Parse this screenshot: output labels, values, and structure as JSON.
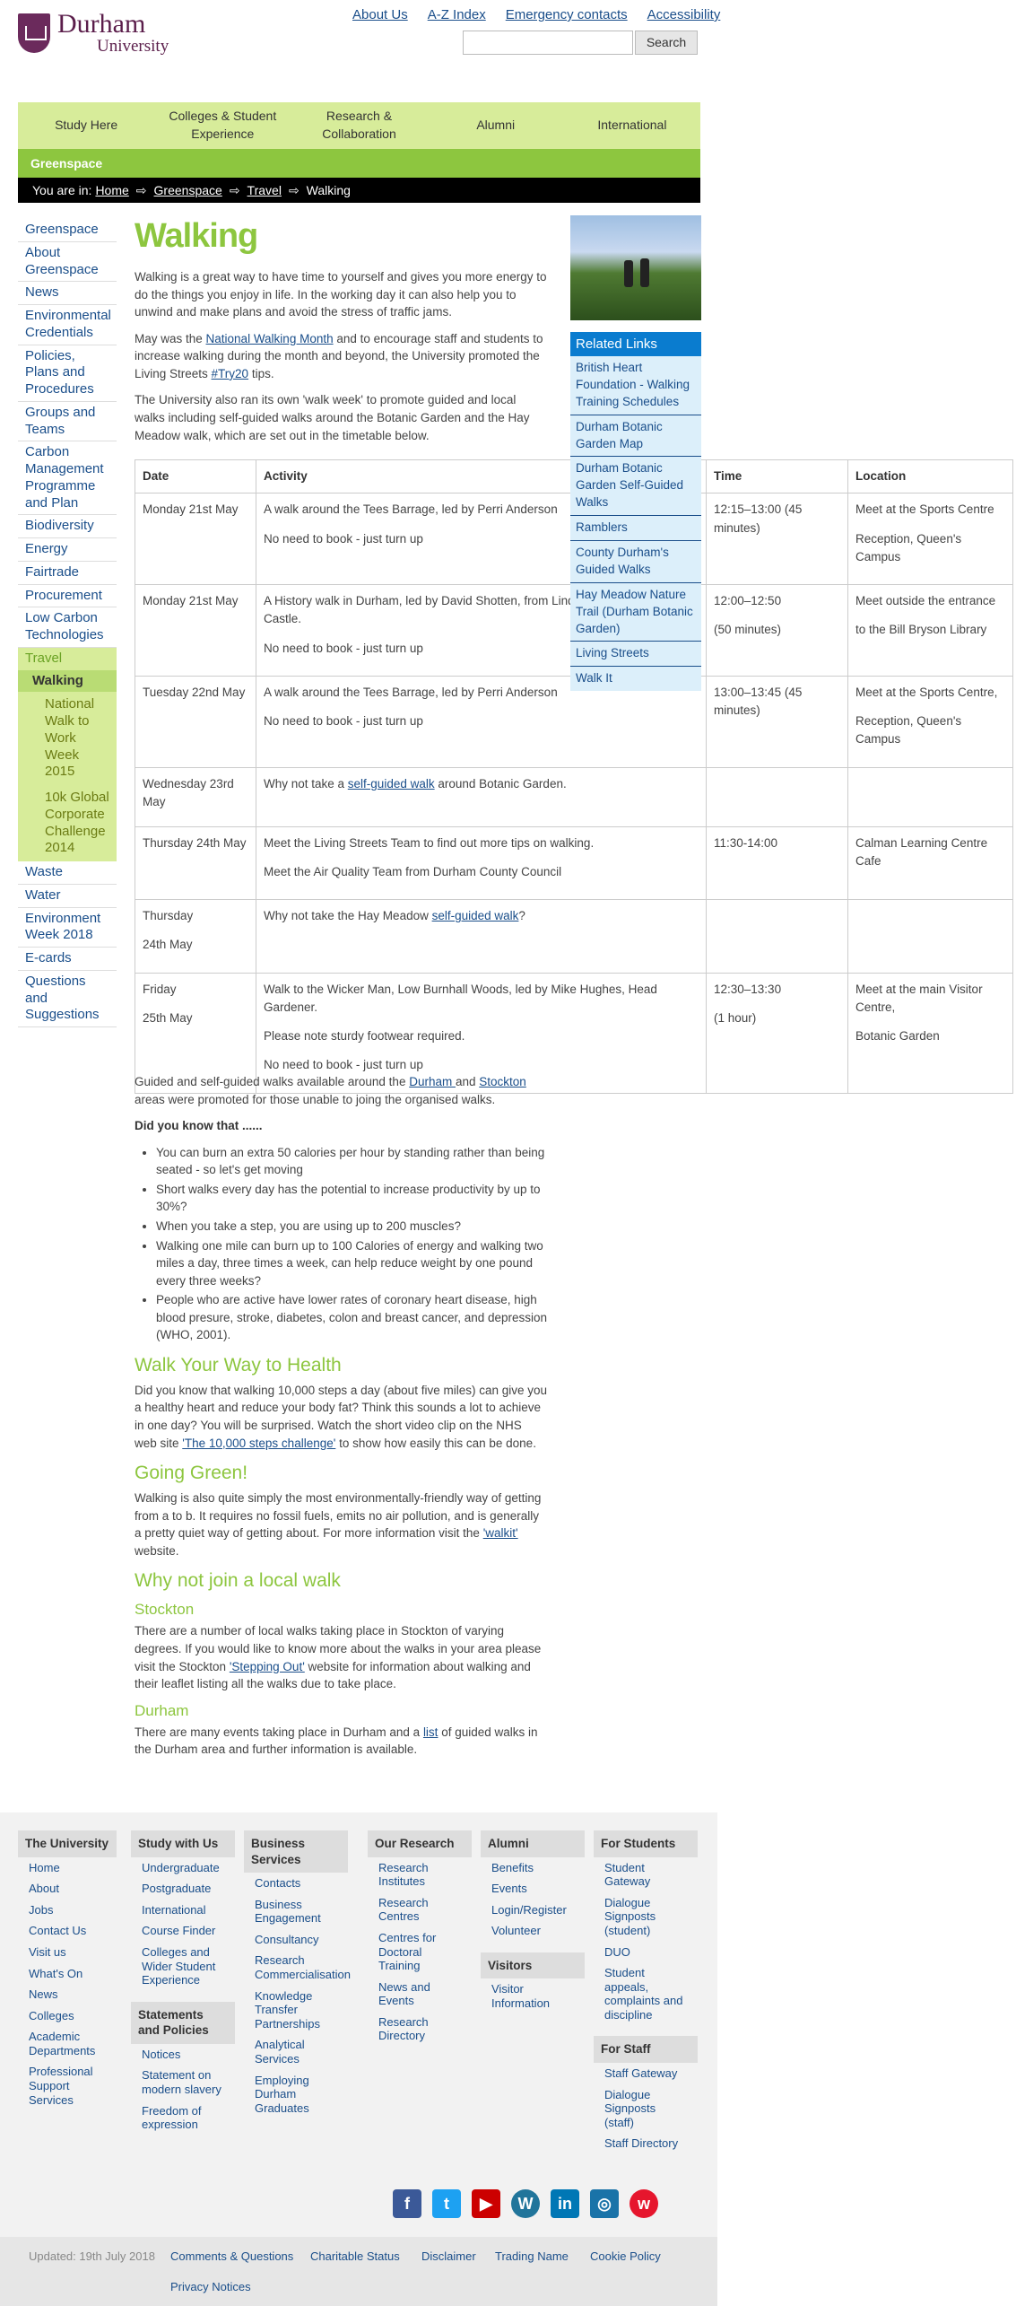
{
  "header": {
    "logo_line1": "Durham",
    "logo_line2": "University",
    "top_links": [
      "About Us",
      "A-Z Index",
      "Emergency contacts",
      "Accessibility"
    ],
    "search_button": "Search",
    "search_placeholder": ""
  },
  "topnav": [
    "Study Here",
    "Colleges & Student Experience",
    "Research & Collaboration",
    "Alumni",
    "International"
  ],
  "section_bar": "Greenspace",
  "breadcrumb": {
    "prefix": "You are in:",
    "items": [
      "Home",
      "Greenspace",
      "Travel",
      "Walking"
    ]
  },
  "sidenav": {
    "items": [
      "Greenspace",
      "About Greenspace",
      "News",
      "Environmental Credentials",
      "Policies, Plans and Procedures",
      "Groups and Teams",
      "Carbon Management Programme and Plan",
      "Biodiversity",
      "Energy",
      "Fairtrade",
      "Procurement",
      "Low Carbon Technologies"
    ],
    "travel": "Travel",
    "walking": "Walking",
    "walking_sub": [
      "National Walk to Work Week 2015",
      "10k Global Corporate Challenge 2014"
    ],
    "items_after": [
      "Waste",
      "Water",
      "Environment Week 2018",
      "E-cards",
      "Questions and Suggestions"
    ]
  },
  "main": {
    "title": "Walking",
    "p1": "Walking is a great way to have time to yourself and gives you more energy to do the things you enjoy in life. In the working day it can also help you to unwind and make plans and avoid the stress of traffic jams.",
    "p2_a": "May was the ",
    "p2_link1": "National Walking Month",
    "p2_b": " and to encourage staff and students to increase walking during the month and beyond, the University promoted the Living Streets ",
    "p2_link2": "#Try20",
    "p2_c": " tips.",
    "p3": "The University also ran its own 'walk week' to promote guided and local walks including self-guided walks around the Botanic Garden and the Hay Meadow walk, which are set out in the timetable below."
  },
  "related": {
    "heading": "Related Links",
    "links": [
      "British Heart Foundation - Walking Training Schedules",
      "Durham Botanic Garden Map",
      "Durham Botanic Garden Self-Guided Walks",
      "Ramblers",
      "County Durham's Guided Walks",
      "Hay Meadow Nature Trail (Durham Botanic Garden)",
      "Living Streets",
      "Walk It"
    ]
  },
  "table": {
    "headers": [
      "Date",
      "Activity",
      "Time",
      "Location"
    ],
    "rows": [
      {
        "date": "Monday 21st May",
        "a1": "A walk around the Tees Barrage, led by Perri Anderson",
        "a2": "No need to book - just turn up",
        "t1": "12:15–13:00 (45 minutes)",
        "t2": "",
        "l1": "Meet at the Sports Centre",
        "l2": "Reception, Queen's Campus"
      },
      {
        "date": "Monday 21st May",
        "a1": "A History walk in Durham, led by David Shotten, from Lindisfarne to Maiden Castle.",
        "a2": "No need to book - just turn up",
        "t1": "12:00–12:50",
        "t2": "(50 minutes)",
        "l1": "Meet outside the entrance",
        "l2": "to the Bill Bryson Library"
      },
      {
        "date": "Tuesday 22nd May",
        "a1": "A walk around the Tees Barrage, led by Perri Anderson",
        "a2": "No need to book - just turn up",
        "t1": "13:00–13:45 (45 minutes)",
        "t2": "",
        "l1": "Meet at the Sports Centre,",
        "l2": "Reception, Queen's Campus"
      },
      {
        "date": "Wednesday 23rd May",
        "a1_pre": "Why not take a ",
        "a1_link": "self-guided walk",
        "a1_post": " around Botanic Garden.",
        "t1": "",
        "l1": ""
      },
      {
        "date": "Thursday 24th May",
        "a1": "Meet the Living Streets Team to find out more tips on walking.",
        "a2": "Meet the Air Quality Team from Durham County Council",
        "t1": "11:30-14:00",
        "l1": "Calman Learning Centre Cafe"
      },
      {
        "date_a": "Thursday",
        "date_b": "24th May",
        "a1_pre": "Why not take the Hay Meadow ",
        "a1_link": "self-guided walk",
        "a1_post": "?",
        "t1": "",
        "l1": ""
      },
      {
        "date_a": "Friday",
        "date_b": "25th May",
        "a1": "Walk to the Wicker Man, Low Burnhall Woods, led by Mike Hughes, Head Gardener.",
        "a2": "Please note sturdy footwear required.",
        "a3": "No need to book - just turn up",
        "t1": "12:30–13:30",
        "t2": "(1 hour)",
        "l1": "Meet at the main Visitor Centre,",
        "l2": "Botanic Garden"
      }
    ]
  },
  "after": {
    "guided_a": "Guided and self-guided walks available around the ",
    "guided_link1": "Durham ",
    "guided_b": "and ",
    "guided_link2": "Stockton",
    "guided_c": " areas were promoted for those unable to joing the organised walks.",
    "dyk": "Did you know that ......",
    "facts": [
      "You can burn an extra 50 calories per hour by standing rather than being seated - so let's get moving",
      "Short walks every day has the potential to increase productivity by up to 30%?",
      "When you take a step, you are using up to 200 muscles?",
      "Walking one mile can burn up to 100 Calories of energy and walking two miles a day, three times a week, can help reduce weight by one pound every three weeks?",
      "People who are active have lower rates of coronary heart disease, high blood presure, stroke, diabetes, colon and breast cancer, and depression (WHO, 2001)."
    ],
    "h_health": "Walk Your Way to Health",
    "health_a": "Did you know that walking 10,000 steps a day (about five miles) can give you a healthy heart and reduce your body fat? Think this sounds a lot to achieve in one day? You will be surprised. Watch the short video clip on the NHS web site ",
    "health_link": "'The 10,000 steps challenge'",
    "health_b": " to show how easily this can be done.",
    "h_green": "Going Green!",
    "green_a": "Walking is also quite simply the most environmentally-friendly way of getting from a to b. It requires no fossil fuels, emits no air pollution, and is generally a pretty quiet way of getting about. For more information visit the ",
    "green_link": "'walkit'",
    "green_b": " website.",
    "h_local": "Why not join a local walk",
    "h_stockton": "Stockton",
    "stockton_a": "There are a number of local walks taking place in Stockton of varying degrees. If you would like to know more about the walks in your area please visit the Stockton ",
    "stockton_link": "'Stepping Out'",
    "stockton_b": " website for information about walking and their leaflet listing all the walks due to take place.",
    "h_durham": "Durham",
    "durham_a": "There are many events taking place in Durham and a ",
    "durham_link": "list",
    "durham_b": " of guided walks in the Durham area and further information is available."
  },
  "footer": {
    "col1": {
      "heading": "The University",
      "links": [
        "Home",
        "About",
        "Jobs",
        "Contact Us",
        "Visit us",
        "What's On",
        "News",
        "Colleges",
        "Academic Departments",
        "Professional Support Services"
      ]
    },
    "col2": {
      "heading": "Study with Us",
      "links": [
        "Undergraduate",
        "Postgraduate",
        "International",
        "Course Finder",
        "Colleges and Wider Student Experience"
      ],
      "heading2": "Statements and Policies",
      "links2": [
        "Notices",
        "Statement on modern slavery",
        "Freedom of expression"
      ]
    },
    "col3": {
      "heading": "Business Services",
      "links": [
        "Contacts",
        "Business Engagement",
        "Consultancy",
        "Research Commercialisation",
        "Knowledge Transfer Partnerships",
        "Analytical Services",
        "Employing Durham Graduates"
      ]
    },
    "col4": {
      "heading": "Our Research",
      "links": [
        "Research Institutes",
        "Research Centres",
        "Centres for Doctoral Training",
        "News and Events",
        "Research Directory"
      ]
    },
    "col5": {
      "heading": "Alumni",
      "links": [
        "Benefits",
        "Events",
        "Login/Register",
        "Volunteer"
      ],
      "heading2": "Visitors",
      "links2": [
        "Visitor Information"
      ]
    },
    "col6": {
      "heading": "For Students",
      "links": [
        "Student Gateway",
        "Dialogue Signposts (student)",
        "DUO",
        "Student appeals, complaints and discipline"
      ],
      "heading2": "For Staff",
      "links2": [
        "Staff Gateway",
        "Dialogue Signposts (staff)",
        "Staff Directory"
      ]
    },
    "social": [
      "facebook-icon",
      "twitter-icon",
      "youtube-icon",
      "wordpress-icon",
      "linkedin-icon",
      "instagram-icon",
      "weibo-icon"
    ],
    "updated": "Updated: 19th July 2018",
    "bottom_links": [
      "Comments & Questions",
      "Charitable Status",
      "Disclaimer",
      "Trading Name",
      "Cookie Policy",
      "Privacy Notices"
    ]
  },
  "colors": {
    "brand": "#5b1e4b",
    "green": "#8dc63f",
    "light_green": "#d7ec9a",
    "link": "#1a4e8a",
    "related_blue": "#0a7ccf"
  }
}
